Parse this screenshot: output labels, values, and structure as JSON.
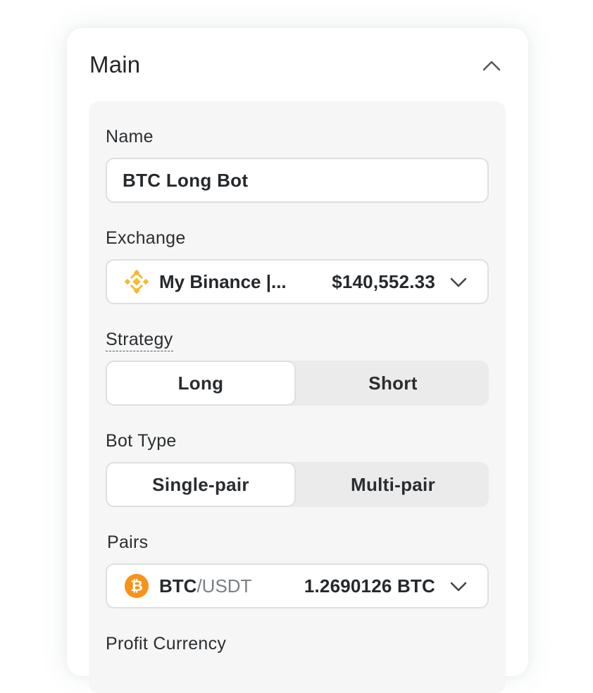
{
  "section": {
    "title": "Main"
  },
  "name_field": {
    "label": "Name",
    "value": "BTC Long Bot"
  },
  "exchange_field": {
    "label": "Exchange",
    "name": "My Binance |...",
    "balance": "$140,552.33",
    "icon": "binance-icon",
    "icon_color": "#F3BA2F"
  },
  "strategy": {
    "label": "Strategy",
    "options": [
      "Long",
      "Short"
    ],
    "selected": "Long"
  },
  "bot_type": {
    "label": "Bot Type",
    "options": [
      "Single-pair",
      "Multi-pair"
    ],
    "selected": "Single-pair"
  },
  "pairs_field": {
    "label": "Pairs",
    "base": "BTC",
    "quote": "/USDT",
    "amount": "1.2690126 BTC",
    "icon": "bitcoin-icon",
    "icon_color": "#F7931A"
  },
  "profit_currency": {
    "label": "Profit Currency"
  }
}
